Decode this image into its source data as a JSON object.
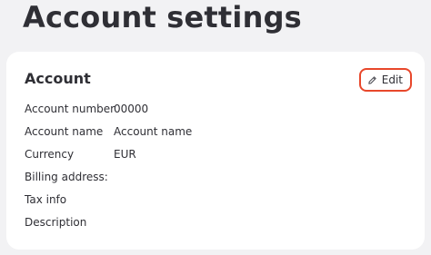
{
  "page": {
    "title": "Account settings"
  },
  "card": {
    "title": "Account",
    "edit_label": "Edit",
    "edit_icon": "pencil-icon",
    "accent_color": "#e8472b",
    "rows": [
      {
        "label": "Account number",
        "value": "00000"
      },
      {
        "label": "Account name",
        "value": "Account name"
      },
      {
        "label": "Currency",
        "value": "EUR"
      },
      {
        "label": "Billing address:",
        "value": ""
      },
      {
        "label": "Tax info",
        "value": ""
      },
      {
        "label": "Description",
        "value": ""
      }
    ]
  }
}
